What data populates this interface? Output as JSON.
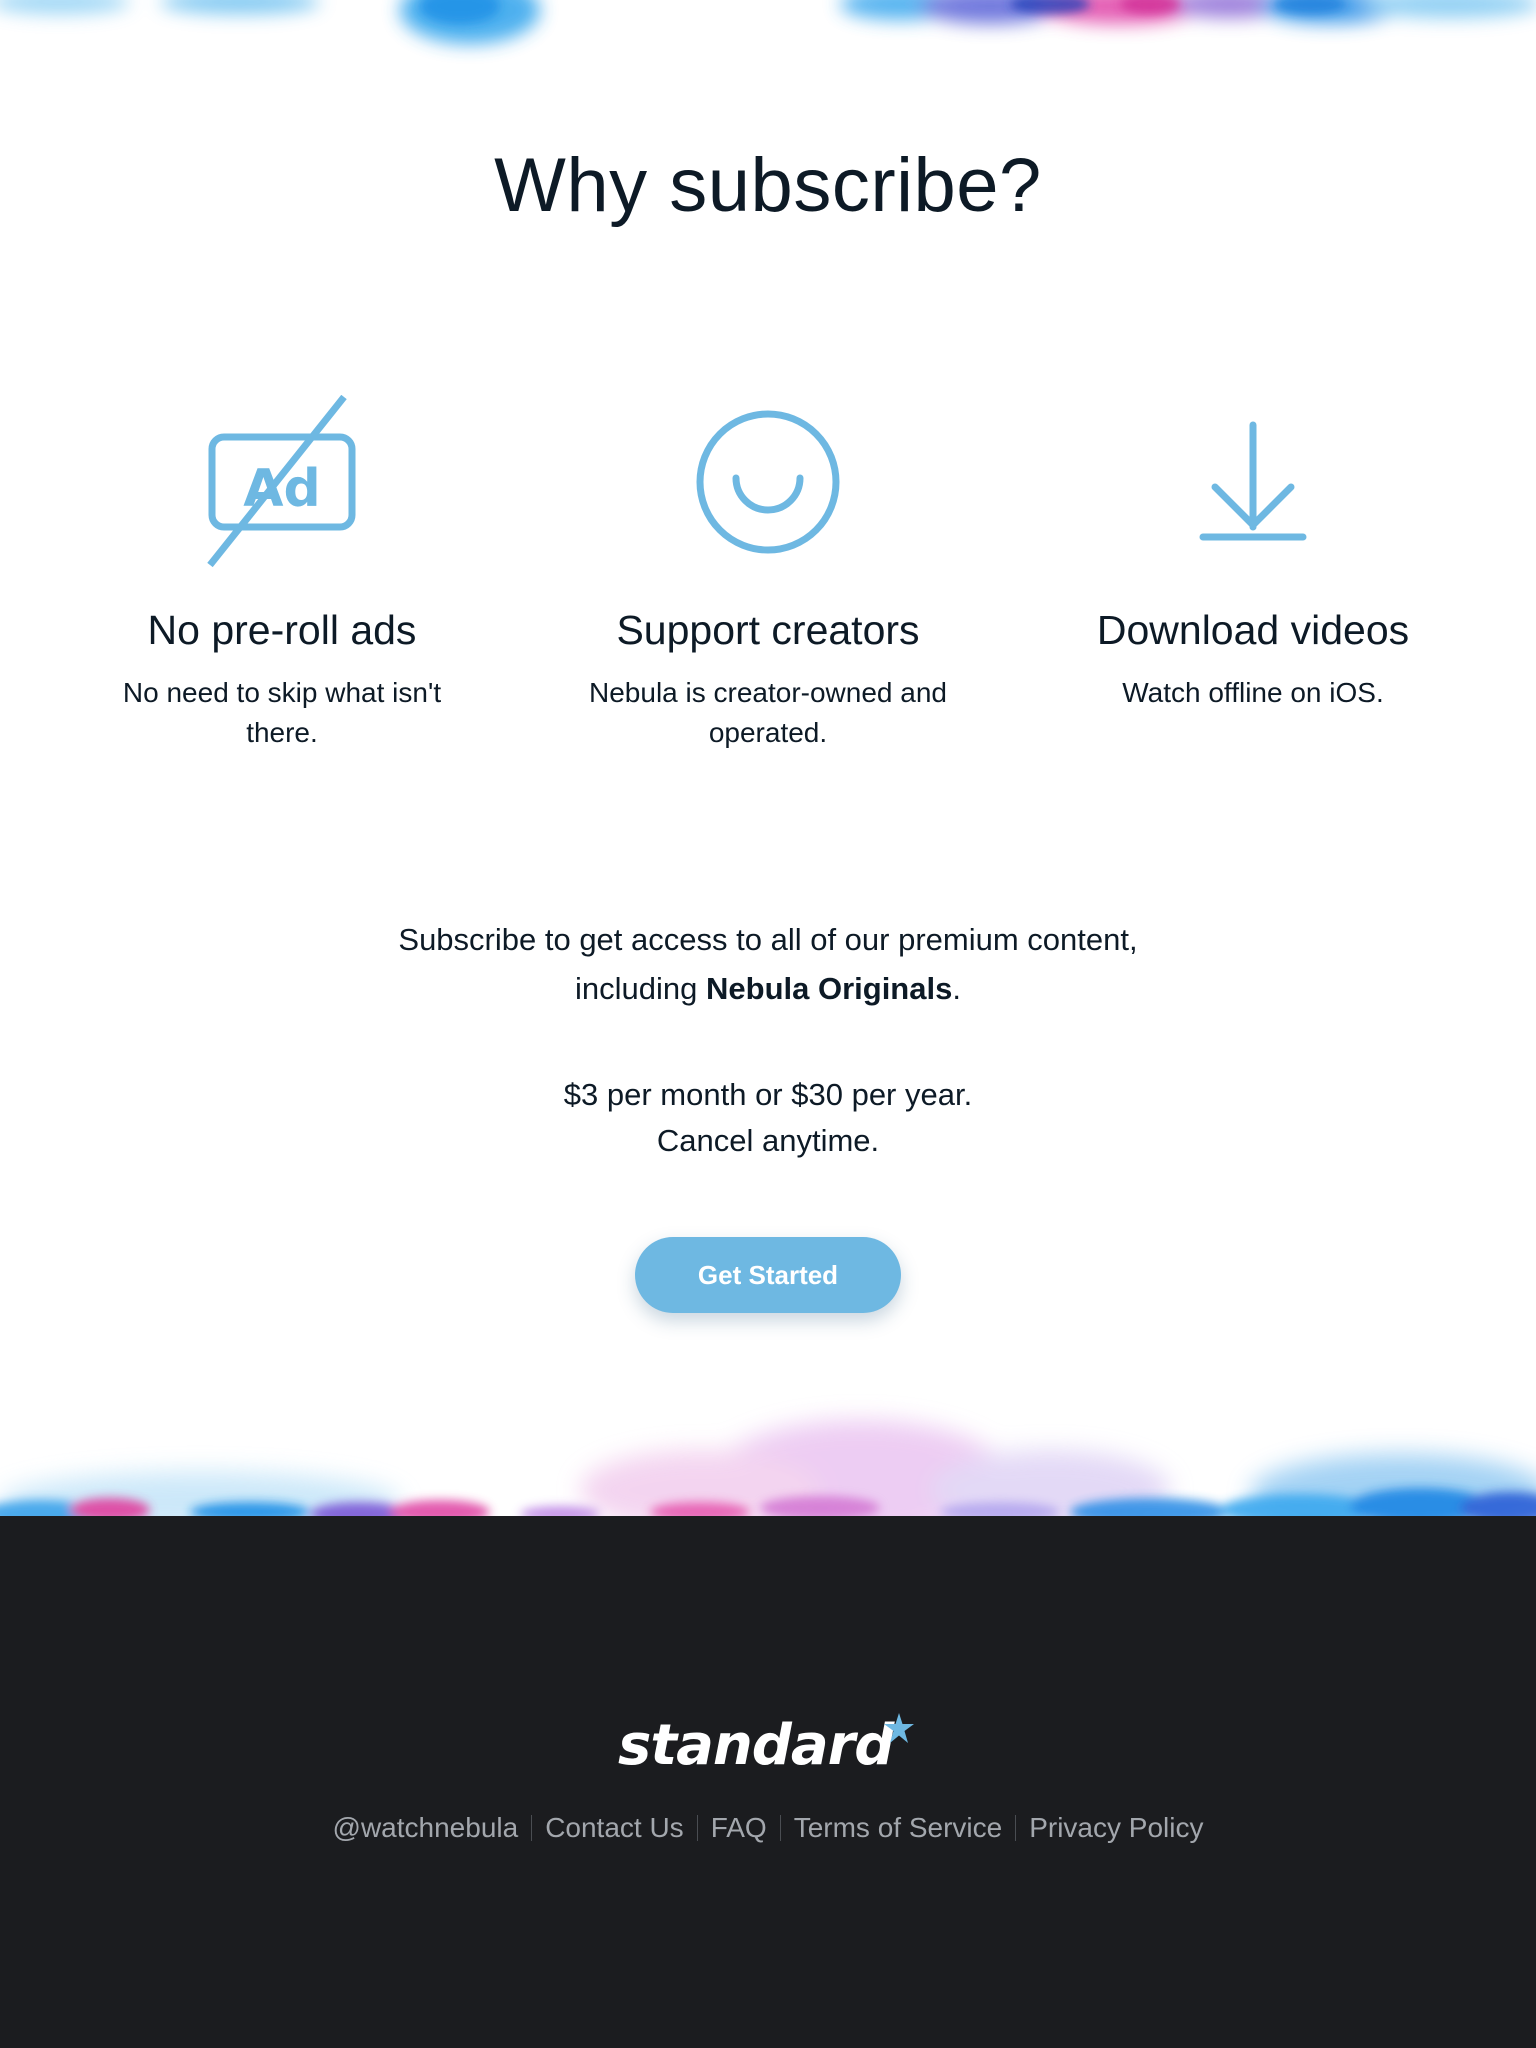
{
  "section": {
    "title": "Why subscribe?"
  },
  "features": [
    {
      "icon": "no-ads-icon",
      "icon_text": "Ad",
      "title": "No pre-roll ads",
      "description": "No need to skip what isn't there."
    },
    {
      "icon": "smile-icon",
      "title": "Support creators",
      "description": "Nebula is creator-owned and operated."
    },
    {
      "icon": "download-icon",
      "title": "Download videos",
      "description": "Watch offline on iOS."
    }
  ],
  "pitch": {
    "line1": "Subscribe to get access to all of our premium content,",
    "line2_prefix": "including ",
    "line2_bold": "Nebula Originals",
    "line2_suffix": "."
  },
  "pricing": {
    "line1": "$3 per month or $30 per year.",
    "line2": "Cancel anytime."
  },
  "cta": {
    "label": "Get Started"
  },
  "footer": {
    "logo_text": "standard",
    "links": [
      "@watchnebula",
      "Contact Us",
      "FAQ",
      "Terms of Service",
      "Privacy Policy"
    ]
  },
  "colors": {
    "accent": "#6eb8e2",
    "text": "#0d1a26",
    "footer_bg": "#1b1c1f",
    "footer_link": "#a3a7ad",
    "paint_blue": "#2e9bea",
    "paint_pink": "#e23fa8",
    "paint_purple": "#7a5ad8"
  }
}
